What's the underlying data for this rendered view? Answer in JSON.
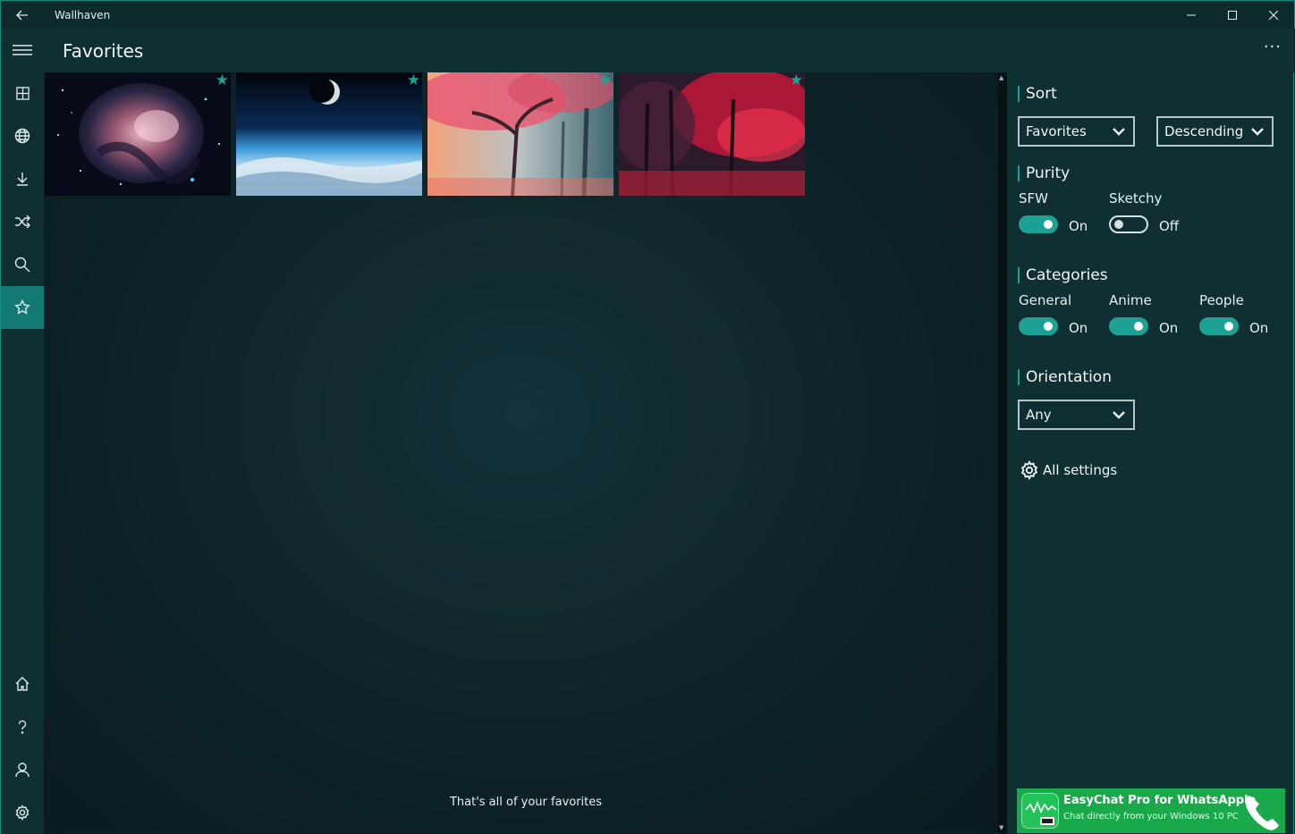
{
  "window": {
    "title": "Wallhaven",
    "back_icon": "back-arrow-icon",
    "minimize_glyph": "—",
    "maximize_glyph": "☐",
    "close_glyph": "✕"
  },
  "header": {
    "title": "Favorites",
    "more_glyph": "···"
  },
  "nav": {
    "top_items": [
      {
        "icon": "hamburger-menu-icon"
      },
      {
        "icon": "grid-icon"
      },
      {
        "icon": "globe-icon"
      },
      {
        "icon": "download-icon"
      },
      {
        "icon": "shuffle-icon"
      },
      {
        "icon": "search-icon"
      },
      {
        "icon": "star-icon",
        "active": true
      }
    ],
    "bottom_items": [
      {
        "icon": "home-icon"
      },
      {
        "icon": "help-icon"
      },
      {
        "icon": "user-icon"
      },
      {
        "icon": "gear-icon"
      }
    ]
  },
  "thumbnails": [
    {
      "subject": "nebula",
      "favorited": true
    },
    {
      "subject": "earth-from-space",
      "favorited": true
    },
    {
      "subject": "pink-forest",
      "favorited": true
    },
    {
      "subject": "red-forest",
      "favorited": true
    }
  ],
  "end_message": "That's all of your favorites",
  "panel": {
    "sort": {
      "title": "Sort",
      "by": "Favorites",
      "order": "Descending"
    },
    "purity": {
      "title": "Purity",
      "sfw": {
        "label": "SFW",
        "state": "On"
      },
      "sketchy": {
        "label": "Sketchy",
        "state": "Off"
      }
    },
    "categories": {
      "title": "Categories",
      "general": {
        "label": "General",
        "state": "On"
      },
      "anime": {
        "label": "Anime",
        "state": "On"
      },
      "people": {
        "label": "People",
        "state": "On"
      }
    },
    "orientation": {
      "title": "Orientation",
      "value": "Any"
    },
    "all_settings": "All settings"
  },
  "ad": {
    "title": "EasyChat Pro for WhatsApple",
    "subtitle": "Chat directly from your Windows 10 PC"
  },
  "colors": {
    "accent": "#1ea195",
    "nav_active": "#127a72",
    "panel_bg": "#0f2f33",
    "content_bg": "#0d2429",
    "ad_bg": "#1aa94a"
  }
}
